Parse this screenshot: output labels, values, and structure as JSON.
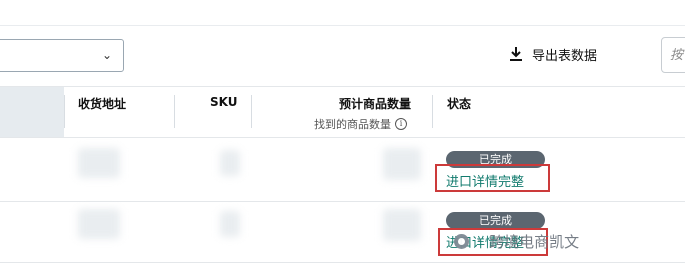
{
  "toolbar": {
    "filter_select": {
      "value": "",
      "chevron_icon": "chevron-down-icon"
    },
    "export_label": "导出表数据",
    "export_icon": "download-icon",
    "search_placeholder": "按"
  },
  "table": {
    "columns": [
      {
        "key": "address",
        "label": "收货地址"
      },
      {
        "key": "sku",
        "label": "SKU"
      },
      {
        "key": "expected_qty",
        "label": "预计商品数量",
        "sublabel": "找到的商品数量",
        "info_icon": "info-icon"
      },
      {
        "key": "status",
        "label": "状态"
      }
    ],
    "rows": [
      {
        "status_badge": "已完成",
        "detail_link": "进口详情完整"
      },
      {
        "status_badge": "已完成",
        "detail_link": "进口详情完整"
      }
    ]
  },
  "watermark": {
    "text": "跨境电商凯文",
    "separator": "·"
  },
  "colors": {
    "accent_link": "#127b6e",
    "badge_bg": "#5b6670",
    "highlight_border": "#cc3a3a",
    "header_shade": "#e6ebef"
  }
}
